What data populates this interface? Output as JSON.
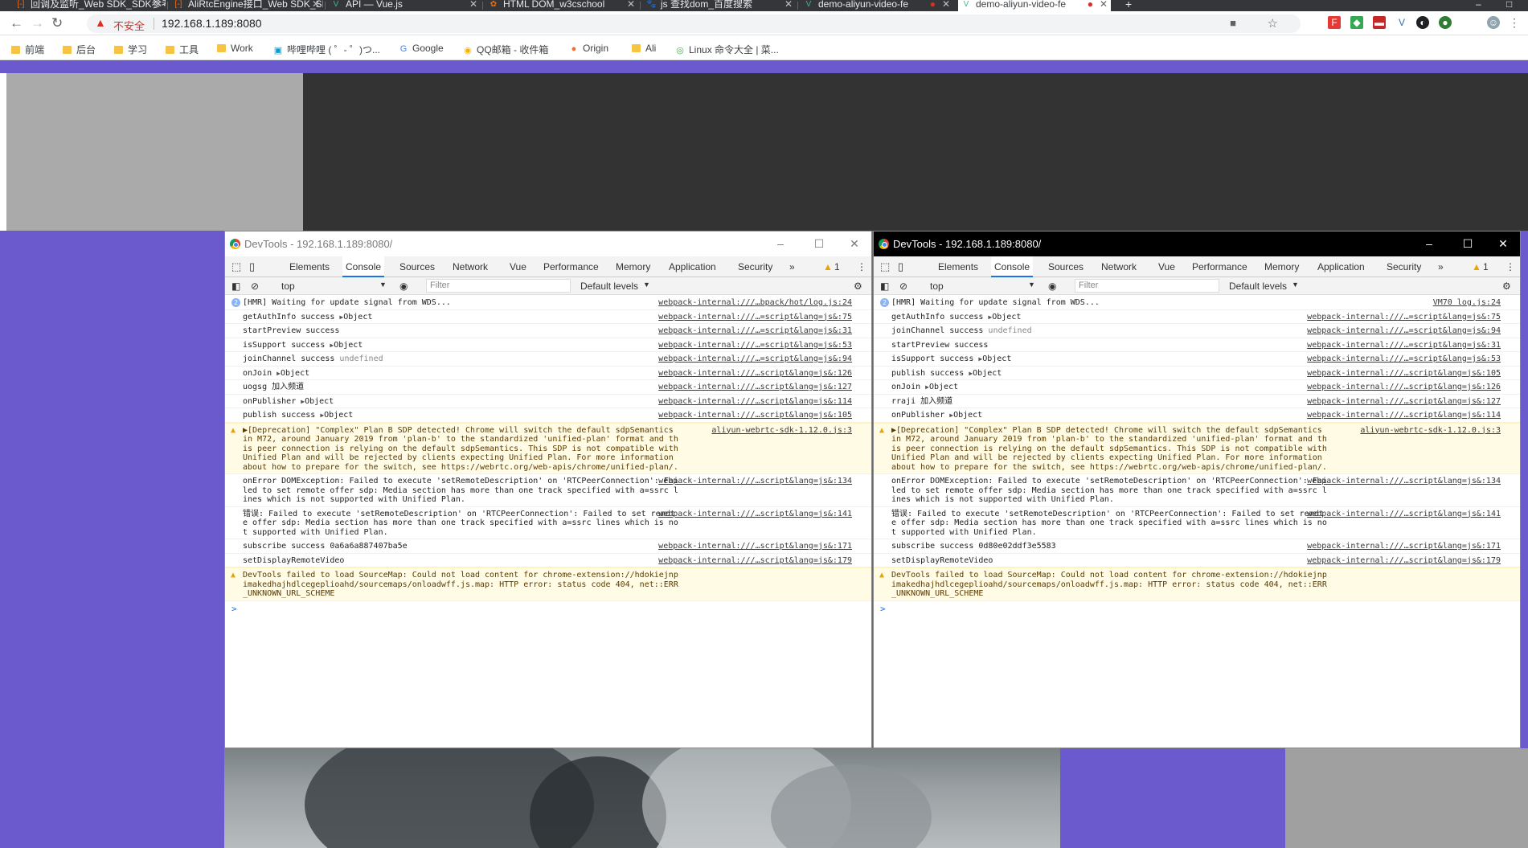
{
  "browser": {
    "tabs": [
      {
        "title": "回调及监听_Web SDK_SDK参考",
        "icon": "[-]"
      },
      {
        "title": "AliRtcEngine接口_Web SDK_SI",
        "icon": "[-]"
      },
      {
        "title": "API — Vue.js",
        "icon": "V"
      },
      {
        "title": "HTML DOM_w3cschool",
        "icon": "✿"
      },
      {
        "title": "js 查找dom_百度搜索",
        "icon": "🐾"
      },
      {
        "title": "demo-aliyun-video-fe",
        "icon": "V"
      },
      {
        "title": "demo-aliyun-video-fe",
        "icon": "V"
      }
    ],
    "address": {
      "insecure_label": "不安全",
      "url": "192.168.1.189:8080"
    },
    "bookmarks": [
      "前端",
      "后台",
      "学习",
      "工具",
      "Work",
      "哔哩哔哩 ( ゜- ゜)つ...",
      "Google",
      "QQ邮箱 - 收件箱",
      "Origin",
      "Ali",
      "Linux 命令大全 | 菜..."
    ]
  },
  "devtools_left": {
    "title": "DevTools - 192.168.1.189:8080/",
    "tabs": [
      "Elements",
      "Console",
      "Sources",
      "Network",
      "Vue",
      "Performance",
      "Memory",
      "Application",
      "Security"
    ],
    "more": "»",
    "warn_count": "1",
    "context": "top",
    "filter_placeholder": "Filter",
    "levels": "Default levels",
    "rows": [
      {
        "kind": "badge",
        "badge": "2",
        "text": "[HMR] Waiting for update signal from WDS...",
        "src": "webpack-internal:///…bpack/hot/log.js:24"
      },
      {
        "kind": "log",
        "text": "getAuthInfo success ",
        "obj": "Object",
        "src": "webpack-internal:///…=script&lang=js&:75"
      },
      {
        "kind": "log",
        "text": "startPreview success",
        "src": "webpack-internal:///…=script&lang=js&:31"
      },
      {
        "kind": "log",
        "text": "isSupport success ",
        "obj": "Object",
        "src": "webpack-internal:///…=script&lang=js&:53"
      },
      {
        "kind": "log",
        "text": "joinChannel success ",
        "dim": "undefined",
        "src": "webpack-internal:///…=script&lang=js&:94"
      },
      {
        "kind": "log",
        "text": "onJoin ",
        "obj": "Object",
        "src": "webpack-internal:///…script&lang=js&:126"
      },
      {
        "kind": "log",
        "text": "uogsg 加入频道",
        "src": "webpack-internal:///…script&lang=js&:127"
      },
      {
        "kind": "log",
        "text": "onPublisher ",
        "obj": "Object",
        "src": "webpack-internal:///…script&lang=js&:114"
      },
      {
        "kind": "log",
        "text": "publish success ",
        "obj": "Object",
        "src": "webpack-internal:///…script&lang=js&:105"
      },
      {
        "kind": "warn",
        "text": "▶[Deprecation] \"Complex\" Plan B SDP detected! Chrome will switch the default sdpSemantics in M72, around January 2019 from 'plan-b' to the standardized 'unified-plan' format and this peer connection is relying on the default sdpSemantics. This SDP is not compatible with Unified Plan and will be rejected by clients expecting Unified Plan. For more information about how to prepare for the switch, see https://webrtc.org/web-apis/chrome/unified-plan/.",
        "src": "aliyun-webrtc-sdk-1.12.0.js:3"
      },
      {
        "kind": "log",
        "text": "onError DOMException: Failed to execute 'setRemoteDescription' on 'RTCPeerConnection': Failed to set remote offer sdp: Media section has more than one track specified with a=ssrc lines which is not supported with Unified Plan.",
        "src": "webpack-internal:///…script&lang=js&:134"
      },
      {
        "kind": "log",
        "text": "错误: Failed to execute 'setRemoteDescription' on 'RTCPeerConnection': Failed to set remote offer sdp: Media section has more than one track specified with a=ssrc lines which is not supported with Unified Plan.",
        "src": "webpack-internal:///…script&lang=js&:141"
      },
      {
        "kind": "log",
        "text": "subscribe success 0a6a6a887407ba5e",
        "src": "webpack-internal:///…script&lang=js&:171"
      },
      {
        "kind": "log",
        "text": "setDisplayRemoteVideo",
        "src": "webpack-internal:///…script&lang=js&:179"
      },
      {
        "kind": "warn",
        "text": "DevTools failed to load SourceMap: Could not load content for chrome-extension://hdokiejnpimakedhajhdlcegeplioahd/sourcemaps/onloadwff.js.map: HTTP error: status code 404, net::ERR_UNKNOWN_URL_SCHEME"
      }
    ],
    "prompt": ">"
  },
  "devtools_right": {
    "title": "DevTools - 192.168.1.189:8080/",
    "tabs": [
      "Elements",
      "Console",
      "Sources",
      "Network",
      "Vue",
      "Performance",
      "Memory",
      "Application",
      "Security"
    ],
    "more": "»",
    "warn_count": "1",
    "context": "top",
    "filter_placeholder": "Filter",
    "levels": "Default levels",
    "rows": [
      {
        "kind": "badge",
        "badge": "2",
        "text": "[HMR] Waiting for update signal from WDS...",
        "src": "VM70 log.js:24"
      },
      {
        "kind": "log",
        "text": "getAuthInfo success ",
        "obj": "Object",
        "src": "webpack-internal:///…=script&lang=js&:75"
      },
      {
        "kind": "log",
        "text": "joinChannel success ",
        "dim": "undefined",
        "src": "webpack-internal:///…=script&lang=js&:94"
      },
      {
        "kind": "log",
        "text": "startPreview success",
        "src": "webpack-internal:///…=script&lang=js&:31"
      },
      {
        "kind": "log",
        "text": "isSupport success ",
        "obj": "Object",
        "src": "webpack-internal:///…=script&lang=js&:53"
      },
      {
        "kind": "log",
        "text": "publish success ",
        "obj": "Object",
        "src": "webpack-internal:///…script&lang=js&:105"
      },
      {
        "kind": "log",
        "text": "onJoin ",
        "obj": "Object",
        "src": "webpack-internal:///…script&lang=js&:126"
      },
      {
        "kind": "log",
        "text": "rraji 加入频道",
        "src": "webpack-internal:///…script&lang=js&:127"
      },
      {
        "kind": "log",
        "text": "onPublisher ",
        "obj": "Object",
        "src": "webpack-internal:///…script&lang=js&:114"
      },
      {
        "kind": "warn",
        "text": "▶[Deprecation] \"Complex\" Plan B SDP detected! Chrome will switch the default sdpSemantics in M72, around January 2019 from 'plan-b' to the standardized 'unified-plan' format and this peer connection is relying on the default sdpSemantics. This SDP is not compatible with Unified Plan and will be rejected by clients expecting Unified Plan. For more information about how to prepare for the switch, see https://webrtc.org/web-apis/chrome/unified-plan/.",
        "src": "aliyun-webrtc-sdk-1.12.0.js:3"
      },
      {
        "kind": "log",
        "text": "onError DOMException: Failed to execute 'setRemoteDescription' on 'RTCPeerConnection': Failed to set remote offer sdp: Media section has more than one track specified with a=ssrc lines which is not supported with Unified Plan.",
        "src": "webpack-internal:///…script&lang=js&:134"
      },
      {
        "kind": "log",
        "text": "错误: Failed to execute 'setRemoteDescription' on 'RTCPeerConnection': Failed to set remote offer sdp: Media section has more than one track specified with a=ssrc lines which is not supported with Unified Plan.",
        "src": "webpack-internal:///…script&lang=js&:141"
      },
      {
        "kind": "log",
        "text": "subscribe success 0d80e02ddf3e5583",
        "src": "webpack-internal:///…script&lang=js&:171"
      },
      {
        "kind": "log",
        "text": "setDisplayRemoteVideo",
        "src": "webpack-internal:///…script&lang=js&:179"
      },
      {
        "kind": "warn",
        "text": "DevTools failed to load SourceMap: Could not load content for chrome-extension://hdokiejnpimakedhajhdlcegeplioahd/sourcemaps/onloadwff.js.map: HTTP error: status code 404, net::ERR_UNKNOWN_URL_SCHEME"
      }
    ],
    "prompt": ">"
  },
  "colors": {
    "page_purple": "#6a5acd",
    "page_dark": "#333333",
    "warn_bg": "#fffbe5",
    "accent": "#1a73e8"
  }
}
